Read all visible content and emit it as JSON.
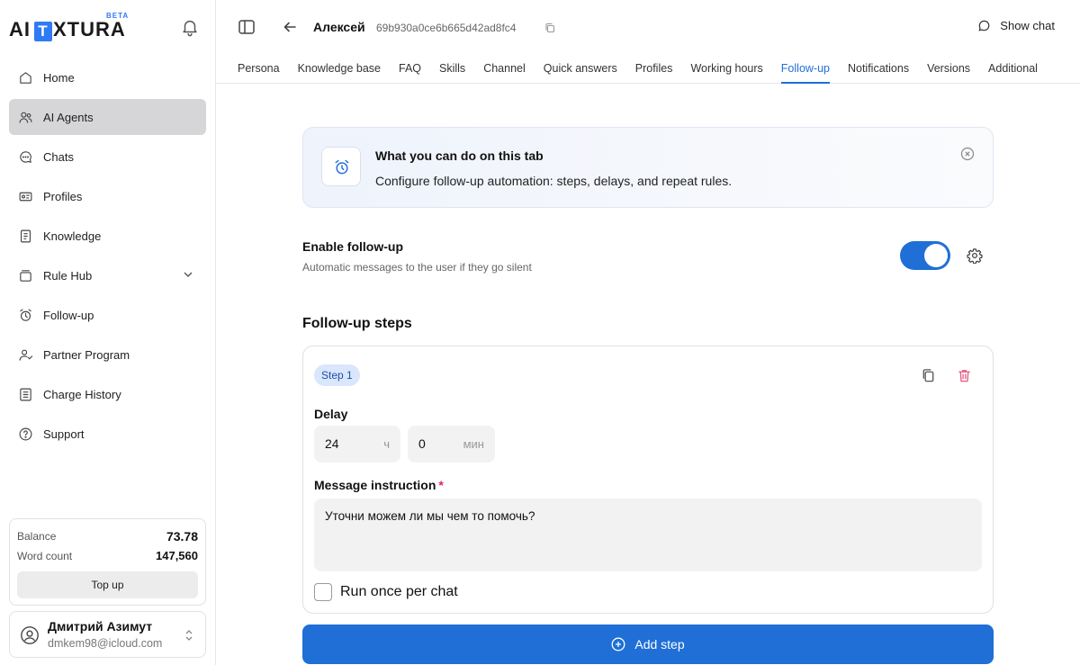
{
  "logo": {
    "prefix": "AI",
    "t": "T",
    "suffix": "XTURA",
    "badge": "BETA"
  },
  "sidebar": {
    "items": [
      {
        "label": "Home",
        "icon": "home-icon"
      },
      {
        "label": "AI Agents",
        "icon": "users-icon",
        "active": true
      },
      {
        "label": "Chats",
        "icon": "chat-icon"
      },
      {
        "label": "Profiles",
        "icon": "id-card-icon"
      },
      {
        "label": "Knowledge",
        "icon": "document-icon"
      },
      {
        "label": "Rule Hub",
        "icon": "stack-icon"
      },
      {
        "label": "Follow-up",
        "icon": "alarm-clock-icon"
      },
      {
        "label": "Partner Program",
        "icon": "partner-icon"
      },
      {
        "label": "Charge History",
        "icon": "list-icon"
      },
      {
        "label": "Support",
        "icon": "help-icon"
      }
    ]
  },
  "balance": {
    "balance_label": "Balance",
    "balance_value": "73.78",
    "words_label": "Word count",
    "words_value": "147,560",
    "topup_label": "Top up"
  },
  "user": {
    "name": "Дмитрий Азимут",
    "email": "dmkem98@icloud.com"
  },
  "header": {
    "agent_name": "Алексей",
    "agent_id": "69b930a0ce6b665d42ad8fc4",
    "show_chat": "Show chat",
    "tabs": [
      "Persona",
      "Knowledge base",
      "FAQ",
      "Skills",
      "Channel",
      "Quick answers",
      "Profiles",
      "Working hours",
      "Follow-up",
      "Notifications",
      "Versions",
      "Additional"
    ],
    "active_tab": "Follow-up"
  },
  "info": {
    "title": "What you can do on this tab",
    "text": "Configure follow-up automation: steps, delays, and repeat rules."
  },
  "enable": {
    "title": "Enable follow-up",
    "subtitle": "Automatic messages to the user if they go silent",
    "enabled": true
  },
  "steps": {
    "title": "Follow-up steps",
    "list": [
      {
        "badge": "Step 1",
        "delay_label": "Delay",
        "hours": "24",
        "hours_unit": "ч",
        "minutes": "0",
        "minutes_unit": "мин",
        "message_label": "Message instruction",
        "required_mark": "*",
        "message": "Уточни можем ли мы чем то помочь?",
        "run_once_label": "Run once per chat",
        "run_once": false
      }
    ],
    "add_label": "Add step"
  },
  "colors": {
    "accent": "#1f6fd6",
    "active_nav": "#d6d6d9",
    "danger": "#e0245e"
  }
}
